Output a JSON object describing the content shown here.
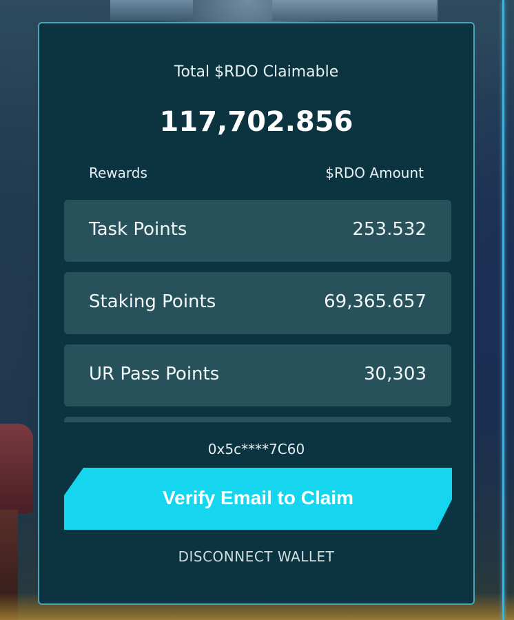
{
  "claim": {
    "label": "Total $RDO Claimable",
    "amount": "117,702.856"
  },
  "table": {
    "headers": {
      "rewards": "Rewards",
      "amount": "$RDO Amount"
    },
    "rows": [
      {
        "name": "Task Points",
        "value": "253.532"
      },
      {
        "name": "Staking Points",
        "value": "69,365.657"
      },
      {
        "name": "UR Pass Points",
        "value": "30,303"
      },
      {
        "name": "",
        "value": ""
      }
    ]
  },
  "wallet": {
    "address": "0x5c****7C60"
  },
  "actions": {
    "verify_label": "Verify Email to Claim",
    "disconnect_label": "DISCONNECT WALLET"
  },
  "colors": {
    "panel_background": "#0b3440",
    "panel_border": "#4aa7b8",
    "row_background": "#27525c",
    "accent_button": "#15d6ee"
  }
}
